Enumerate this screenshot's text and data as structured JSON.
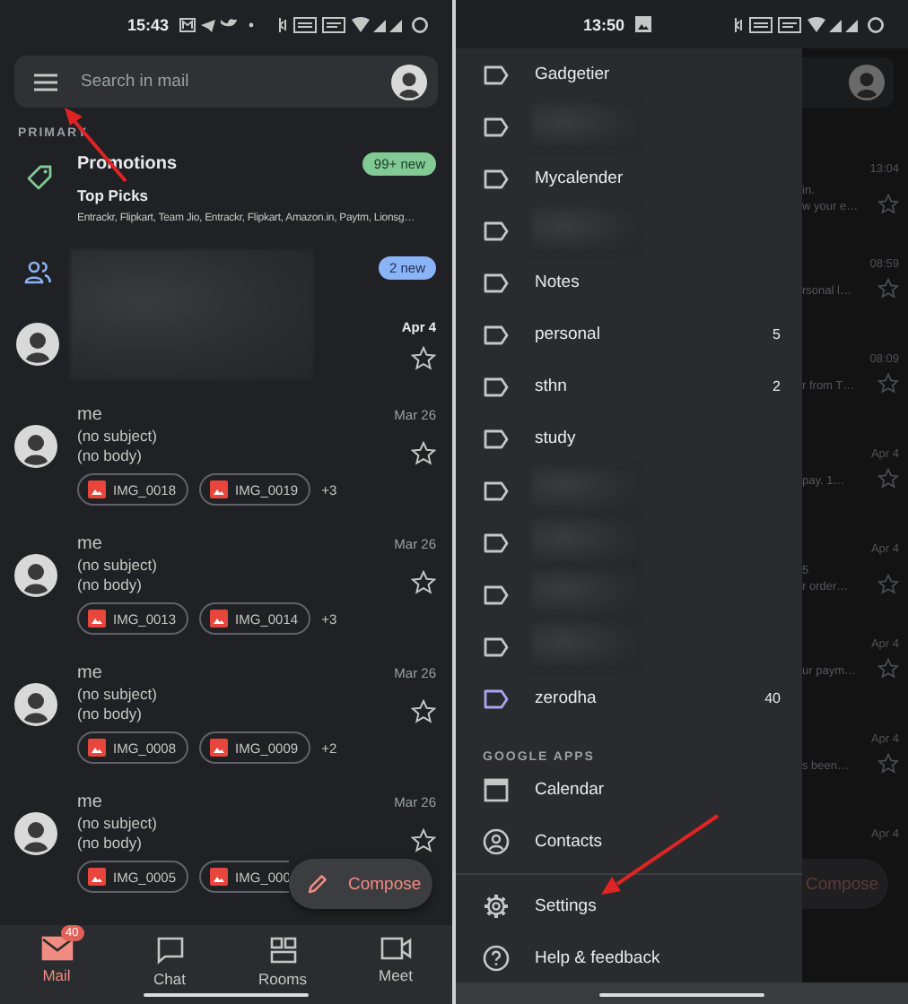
{
  "inbox": {
    "status_bar": {
      "time": "15:43"
    },
    "search": {
      "placeholder": "Search in mail"
    },
    "section": "PRIMARY",
    "categories": [
      {
        "kind": "promotions",
        "title": "Promotions",
        "badge": "99+ new",
        "color": "#81c995",
        "subject": "Top Picks",
        "senders": "Entrackr, Flipkart, Team Jio, Entrackr, Flipkart, Amazon.in, Paytm, Lionsg…"
      },
      {
        "kind": "social",
        "badge": "2 new",
        "color": "#8ab4f8",
        "date": "Apr 4",
        "starred": false
      }
    ],
    "mails": [
      {
        "sender": "me",
        "subject": "(no subject)",
        "body": "(no body)",
        "date": "Mar 26",
        "starred": false,
        "attachments": [
          "IMG_0018",
          "IMG_0019"
        ],
        "more": "+3"
      },
      {
        "sender": "me",
        "subject": "(no subject)",
        "body": "(no body)",
        "date": "Mar 26",
        "starred": false,
        "attachments": [
          "IMG_0013",
          "IMG_0014"
        ],
        "more": "+3"
      },
      {
        "sender": "me",
        "subject": "(no subject)",
        "body": "(no body)",
        "date": "Mar 26",
        "starred": false,
        "attachments": [
          "IMG_0008",
          "IMG_0009"
        ],
        "more": "+2"
      },
      {
        "sender": "me",
        "subject": "(no subject)",
        "body": "(no body)",
        "date": "Mar 26",
        "starred": false,
        "attachments": [
          "IMG_0005",
          "IMG_000"
        ]
      }
    ],
    "compose": "Compose",
    "bottom_nav": [
      {
        "kind": "mail",
        "label": "Mail",
        "selected": true,
        "badge": "40"
      },
      {
        "kind": "chat",
        "label": "Chat",
        "selected": false
      },
      {
        "kind": "rooms",
        "label": "Rooms",
        "selected": false
      },
      {
        "kind": "meet",
        "label": "Meet",
        "selected": false
      }
    ]
  },
  "drawer_screen": {
    "status_bar": {
      "time": "13:50"
    },
    "labels": [
      {
        "kind": "label",
        "name": "Gadgetier",
        "color": "#c4c7c5"
      },
      {
        "kind": "hidden",
        "color": "#c4c7c5"
      },
      {
        "kind": "label",
        "name": "Mycalender",
        "color": "#c4c7c5"
      },
      {
        "kind": "hidden",
        "color": "#c4c7c5"
      },
      {
        "kind": "label",
        "name": "Notes",
        "color": "#c4c7c5"
      },
      {
        "kind": "label",
        "name": "personal",
        "count": "5",
        "color": "#c4c7c5"
      },
      {
        "kind": "label",
        "name": "sthn",
        "count": "2",
        "color": "#c4c7c5"
      },
      {
        "kind": "label",
        "name": "study",
        "color": "#c4c7c5"
      },
      {
        "kind": "hidden",
        "color": "#c4c7c5"
      },
      {
        "kind": "hidden",
        "color": "#c4c7c5"
      },
      {
        "kind": "hidden",
        "color": "#c4c7c5"
      },
      {
        "kind": "hidden",
        "color": "#c4c7c5"
      },
      {
        "kind": "label",
        "name": "zerodha",
        "count": "40",
        "color": "#aaa4f0"
      }
    ],
    "apps_heading": "GOOGLE APPS",
    "apps": [
      {
        "kind": "calendar",
        "label": "Calendar"
      },
      {
        "kind": "contacts",
        "label": "Contacts"
      }
    ],
    "footer": [
      {
        "kind": "settings",
        "label": "Settings"
      },
      {
        "kind": "help",
        "label": "Help & feedback"
      }
    ],
    "background": {
      "rows": [
        {
          "date": "13:04",
          "lines": [
            "in.",
            "w your e…"
          ]
        },
        {
          "date": "08:59",
          "lines": [
            "rsonal l…"
          ]
        },
        {
          "date": "08:09",
          "lines": [
            "r from T…"
          ]
        },
        {
          "date": "Apr 4",
          "lines": [
            "pay. 1…"
          ]
        },
        {
          "date": "Apr 4",
          "lines": [
            "5",
            "r order…"
          ]
        },
        {
          "date": "Apr 4",
          "lines": [
            "ur paym…"
          ]
        },
        {
          "date": "Apr 4",
          "lines": [
            "s been…"
          ]
        },
        {
          "date": "Apr 4"
        }
      ],
      "compose": "Compose"
    }
  }
}
